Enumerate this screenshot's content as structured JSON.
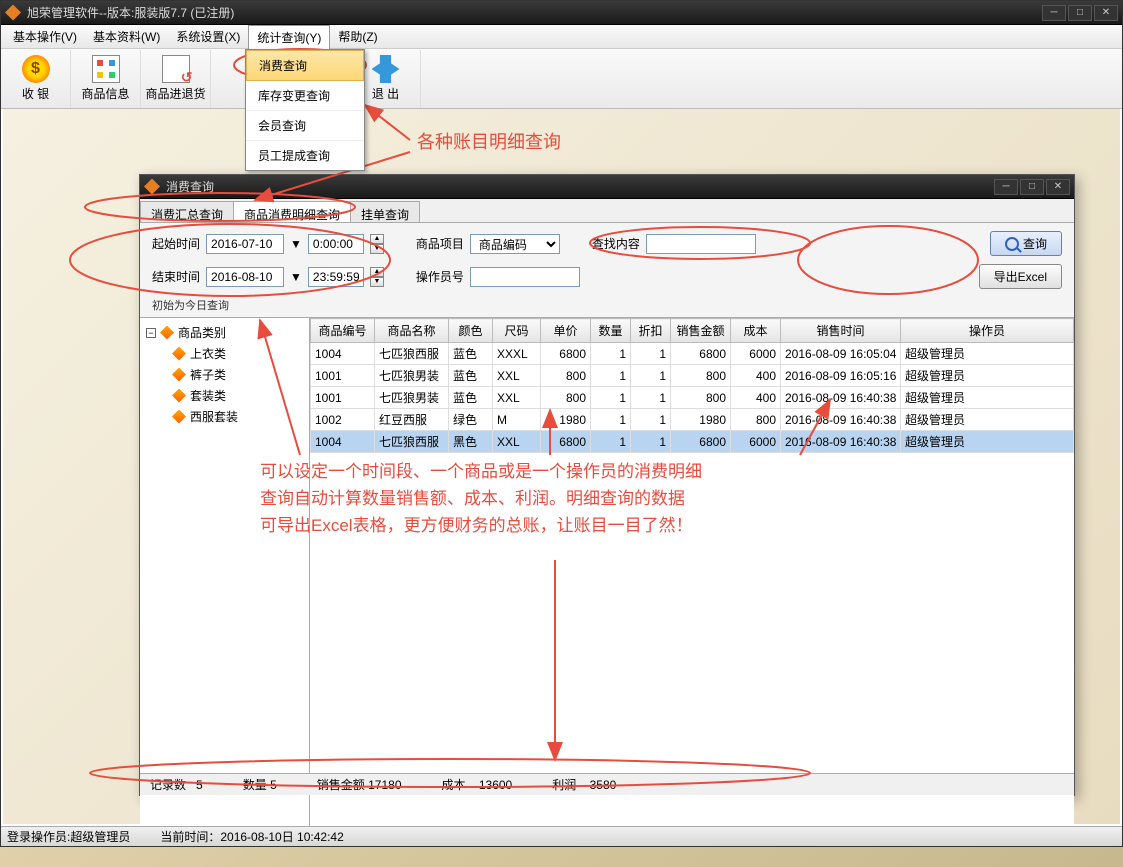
{
  "window": {
    "title": "旭荣管理软件--版本:服装版7.7 (已注册)"
  },
  "menubar": {
    "items": [
      "基本操作(V)",
      "基本资料(W)",
      "系统设置(X)",
      "统计查询(Y)",
      "帮助(Z)"
    ]
  },
  "dropdown": {
    "items": [
      "消费查询",
      "库存变更查询",
      "会员查询",
      "员工提成查询"
    ]
  },
  "toolbar": {
    "cashier": "收 银",
    "product_info": "商品信息",
    "product_return": "商品进退货",
    "exit": "退 出"
  },
  "annotations": {
    "top": "各种账目明细查询",
    "middle": "可以设定一个时间段、一个商品或是一个操作员的消费明细\n查询自动计算数量销售额、成本、利润。明细查询的数据\n可导出Excel表格，更方便财务的总账，让账目一目了然！"
  },
  "inner_window": {
    "title": "消费查询",
    "tabs": [
      "消费汇总查询",
      "商品消费明细查询",
      "挂单查询"
    ],
    "filters": {
      "start_label": "起始时间",
      "start_date": "2016-07-10",
      "start_time": "0:00:00",
      "end_label": "结束时间",
      "end_date": "2016-08-10",
      "end_time": "23:59:59",
      "hint": "初始为今日查询",
      "item_label": "商品项目",
      "item_value": "商品编码",
      "search_label": "查找内容",
      "search_value": "",
      "operator_label": "操作员号",
      "operator_value": "",
      "query_btn": "查询",
      "export_btn": "导出Excel"
    },
    "tree": {
      "root": "商品类别",
      "children": [
        "上衣类",
        "裤子类",
        "套装类",
        "西服套装"
      ]
    },
    "grid": {
      "headers": [
        "商品编号",
        "商品名称",
        "颜色",
        "尺码",
        "单价",
        "数量",
        "折扣",
        "销售金额",
        "成本",
        "销售时间",
        "操作员"
      ],
      "rows": [
        {
          "code": "1004",
          "name": "七匹狼西服",
          "color": "蓝色",
          "size": "XXXL",
          "price": "6800",
          "qty": "1",
          "disc": "1",
          "amount": "6800",
          "cost": "6000",
          "time": "2016-08-09 16:05:04",
          "op": "超级管理员"
        },
        {
          "code": "1001",
          "name": "七匹狼男装",
          "color": "蓝色",
          "size": "XXL",
          "price": "800",
          "qty": "1",
          "disc": "1",
          "amount": "800",
          "cost": "400",
          "time": "2016-08-09 16:05:16",
          "op": "超级管理员"
        },
        {
          "code": "1001",
          "name": "七匹狼男装",
          "color": "蓝色",
          "size": "XXL",
          "price": "800",
          "qty": "1",
          "disc": "1",
          "amount": "800",
          "cost": "400",
          "time": "2016-08-09 16:40:38",
          "op": "超级管理员"
        },
        {
          "code": "1002",
          "name": "红豆西服",
          "color": "绿色",
          "size": "M",
          "price": "1980",
          "qty": "1",
          "disc": "1",
          "amount": "1980",
          "cost": "800",
          "time": "2016-08-09 16:40:38",
          "op": "超级管理员"
        },
        {
          "code": "1004",
          "name": "七匹狼西服",
          "color": "黑色",
          "size": "XXL",
          "price": "6800",
          "qty": "1",
          "disc": "1",
          "amount": "6800",
          "cost": "6000",
          "time": "2016-08-09 16:40:38",
          "op": "超级管理员"
        }
      ]
    },
    "status": {
      "records_label": "记录数",
      "records": "5",
      "qty_label": "数量",
      "qty": "5",
      "sales_label": "销售金额",
      "sales": "17180",
      "cost_label": "成本",
      "cost": "13600",
      "profit_label": "利润",
      "profit": "3580"
    }
  },
  "footer": {
    "operator": "登录操作员:超级管理员",
    "time": "当前时间：2016-08-10日 10:42:42"
  }
}
